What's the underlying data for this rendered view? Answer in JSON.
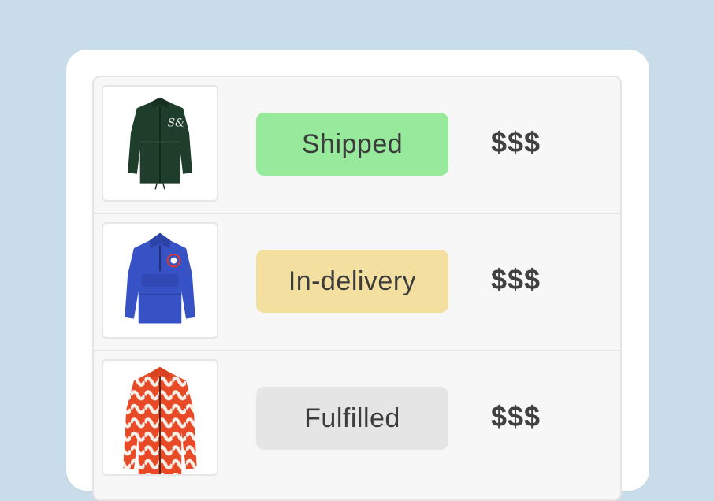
{
  "orders": [
    {
      "status": "Shipped",
      "status_color": "#97ea9c",
      "price": "$$$",
      "product_icon": "green-windbreaker-jacket"
    },
    {
      "status": "In-delivery",
      "status_color": "#f3df9f",
      "price": "$$$",
      "product_icon": "blue-anorak-jacket"
    },
    {
      "status": "Fulfilled",
      "status_color": "#e5e5e5",
      "price": "$$$",
      "product_icon": "orange-pattern-jacket"
    }
  ]
}
